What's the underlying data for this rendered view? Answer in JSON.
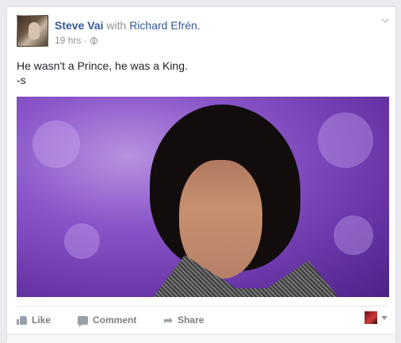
{
  "post": {
    "author": "Steve Vai",
    "with_word": " with ",
    "tagged": "Richard Efrén.",
    "time": "19 hrs",
    "time_sep": "·",
    "text_line1": "He wasn't a Prince, he was a King.",
    "text_line2": "-s"
  },
  "actions": {
    "like": "Like",
    "comment": "Comment",
    "share": "Share"
  },
  "icons": {
    "menu": "chevron-down-icon",
    "privacy": "globe-icon"
  }
}
